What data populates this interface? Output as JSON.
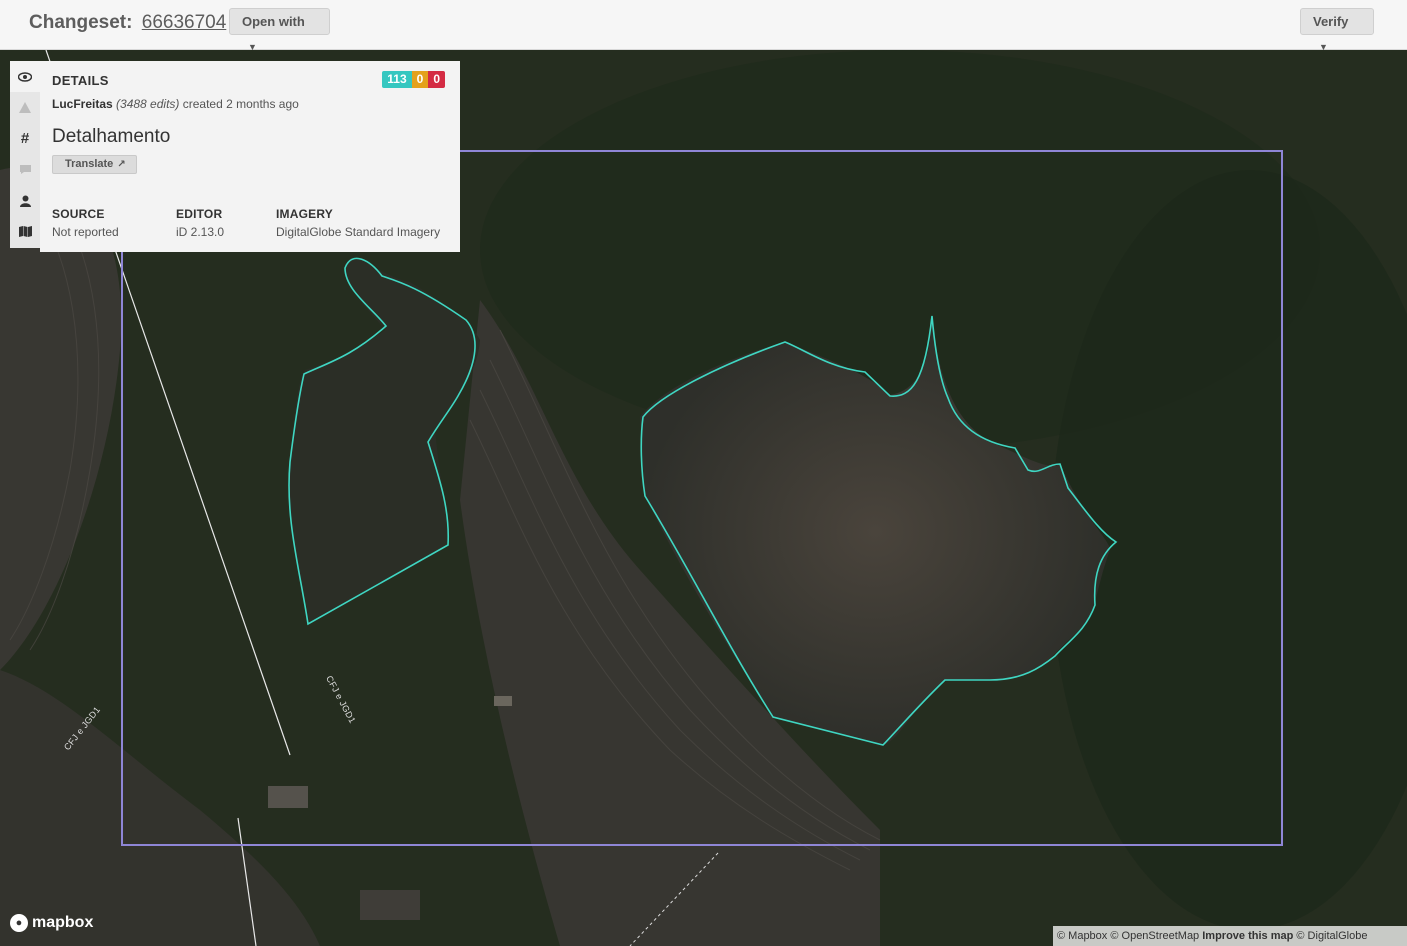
{
  "header": {
    "title_prefix": "Changeset:",
    "changeset_id": "66636704",
    "open_with_label": "Open with",
    "verify_label": "Verify"
  },
  "side_tabs": [
    {
      "icon": "eye-icon",
      "active": true
    },
    {
      "icon": "warning-icon",
      "active": false
    },
    {
      "icon": "hashtag-icon",
      "active": false
    },
    {
      "icon": "comment-icon",
      "active": false
    },
    {
      "icon": "user-icon",
      "active": false
    },
    {
      "icon": "map-icon",
      "active": false
    }
  ],
  "details": {
    "heading": "DETAILS",
    "counts": {
      "added": "113",
      "modified": "0",
      "deleted": "0"
    },
    "user": "LucFreitas",
    "edits": "(3488 edits)",
    "created": "created 2 months ago",
    "comment": "Detalhamento",
    "translate_label": "Translate",
    "props": [
      {
        "key": "SOURCE",
        "value": "Not reported"
      },
      {
        "key": "EDITOR",
        "value": "iD 2.13.0"
      },
      {
        "key": "IMAGERY",
        "value": "DigitalGlobe Standard Imagery"
      }
    ]
  },
  "map": {
    "road_labels": [
      "CFJ e JGD1",
      "CFJ e JGD1"
    ],
    "colors": {
      "bbox": "#8f86d6",
      "feature": "#3fd6c2",
      "background": "#2b2d27"
    }
  },
  "footer": {
    "logo_text": "mapbox",
    "attribution": {
      "mapbox": "© Mapbox",
      "osm": "© OpenStreetMap",
      "improve": "Improve this map",
      "digitalglobe": "© DigitalGlobe"
    }
  }
}
